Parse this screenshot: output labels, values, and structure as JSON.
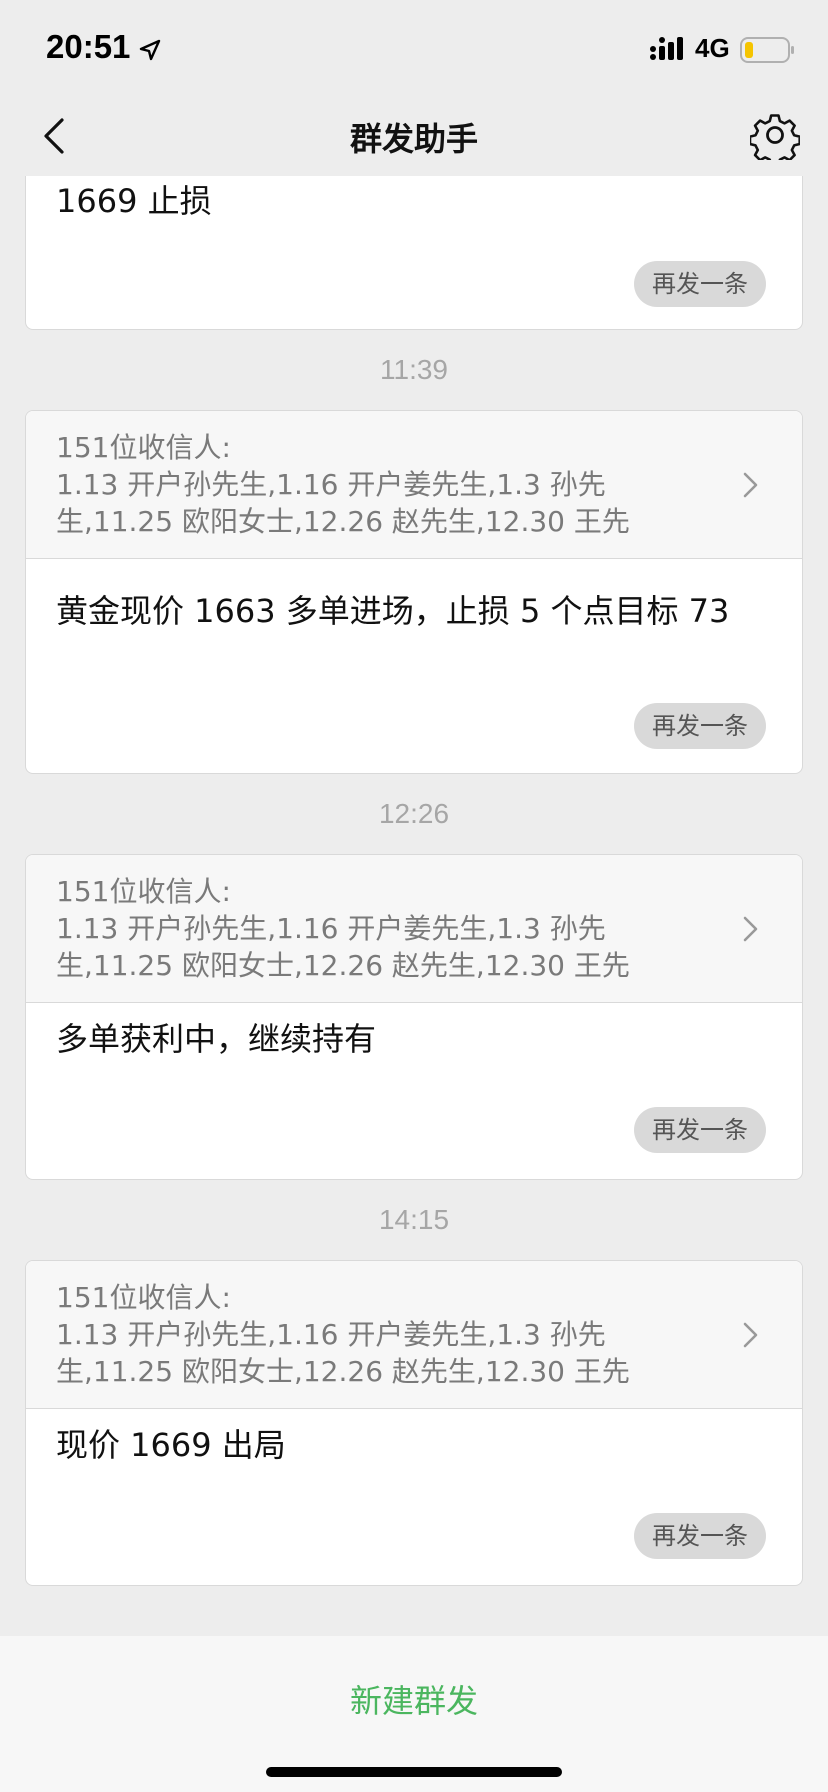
{
  "status_bar": {
    "time": "20:51",
    "network": "4G",
    "icons": [
      "location-arrow-icon",
      "signal-icon",
      "battery-icon"
    ],
    "battery_color": "#f5c400"
  },
  "nav": {
    "title": "群发助手",
    "icons": [
      "back-chevron-icon",
      "gear-icon"
    ]
  },
  "first_card": {
    "message": "1669 止损",
    "resend_label": "再发一条"
  },
  "broadcasts": [
    {
      "time": "11:39",
      "recipients_header": "151位收信人:",
      "recipients_line1": "1.13 开户孙先生,1.16 开户姜先生,1.3 孙先",
      "recipients_line2": "生,11.25 欧阳女士,12.26 赵先生,12.30 王先",
      "message": "黄金现价 1663 多单进场，止损 5 个点目标 73",
      "resend_label": "再发一条"
    },
    {
      "time": "12:26",
      "recipients_header": "151位收信人:",
      "recipients_line1": "1.13 开户孙先生,1.16 开户姜先生,1.3 孙先",
      "recipients_line2": "生,11.25 欧阳女士,12.26 赵先生,12.30 王先",
      "message": "多单获利中，继续持有",
      "resend_label": "再发一条"
    },
    {
      "time": "14:15",
      "recipients_header": "151位收信人:",
      "recipients_line1": "1.13 开户孙先生,1.16 开户姜先生,1.3 孙先",
      "recipients_line2": "生,11.25 欧阳女士,12.26 赵先生,12.30 王先",
      "message": "现价 1669 出局",
      "resend_label": "再发一条"
    }
  ],
  "bottom": {
    "new_broadcast_label": "新建群发",
    "accent_color": "#4bb65f"
  }
}
